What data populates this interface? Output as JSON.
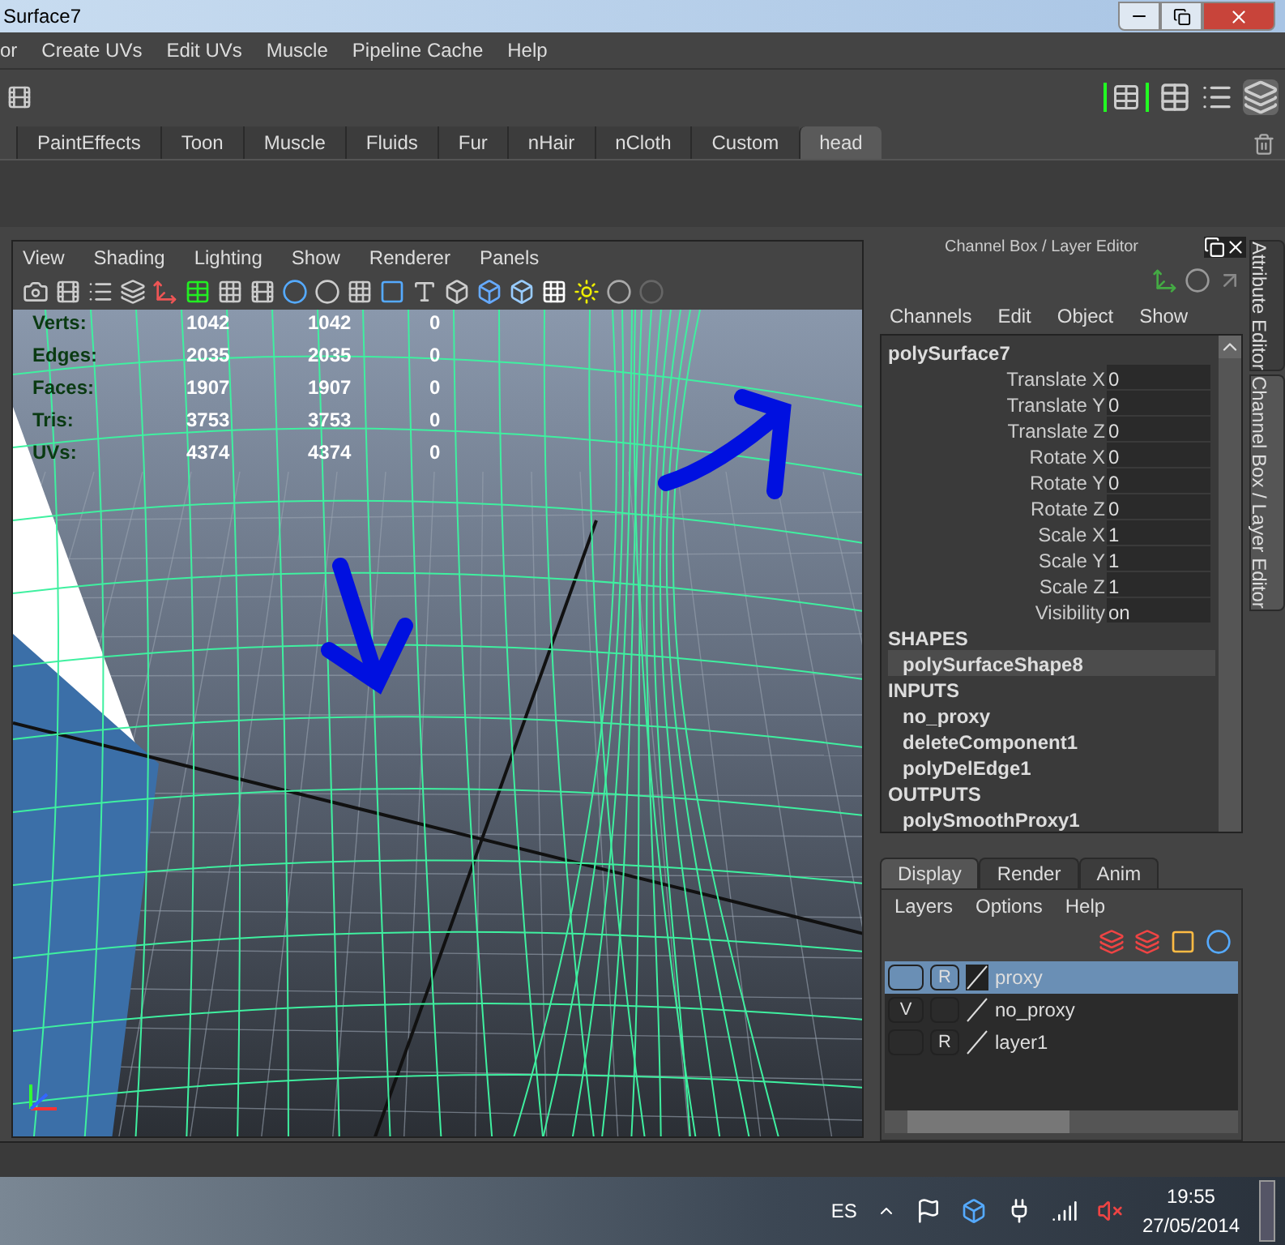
{
  "window": {
    "title": "Surface7"
  },
  "menu_bar": [
    "or",
    "Create UVs",
    "Edit UVs",
    "Muscle",
    "Pipeline Cache",
    "Help"
  ],
  "shelf_tabs": [
    {
      "label": "PaintEffects",
      "selected": false
    },
    {
      "label": "Toon",
      "selected": false
    },
    {
      "label": "Muscle",
      "selected": false
    },
    {
      "label": "Fluids",
      "selected": false
    },
    {
      "label": "Fur",
      "selected": false
    },
    {
      "label": "nHair",
      "selected": false
    },
    {
      "label": "nCloth",
      "selected": false
    },
    {
      "label": "Custom",
      "selected": false
    },
    {
      "label": "head",
      "selected": true
    }
  ],
  "viewport": {
    "menu": [
      "View",
      "Shading",
      "Lighting",
      "Show",
      "Renderer",
      "Panels"
    ],
    "hud": [
      {
        "label": "Verts:",
        "values": [
          "1042",
          "1042",
          "0"
        ]
      },
      {
        "label": "Edges:",
        "values": [
          "2035",
          "2035",
          "0"
        ]
      },
      {
        "label": "Faces:",
        "values": [
          "1907",
          "1907",
          "0"
        ]
      },
      {
        "label": "Tris:",
        "values": [
          "3753",
          "3753",
          "0"
        ]
      },
      {
        "label": "UVs:",
        "values": [
          "4374",
          "4374",
          "0"
        ]
      }
    ]
  },
  "channel_box": {
    "title": "Channel Box / Layer Editor",
    "menu": [
      "Channels",
      "Edit",
      "Object",
      "Show"
    ],
    "object": "polySurface7",
    "attributes": [
      {
        "name": "Translate X",
        "value": "0"
      },
      {
        "name": "Translate Y",
        "value": "0"
      },
      {
        "name": "Translate Z",
        "value": "0"
      },
      {
        "name": "Rotate X",
        "value": "0"
      },
      {
        "name": "Rotate Y",
        "value": "0"
      },
      {
        "name": "Rotate Z",
        "value": "0"
      },
      {
        "name": "Scale X",
        "value": "1"
      },
      {
        "name": "Scale Y",
        "value": "1"
      },
      {
        "name": "Scale Z",
        "value": "1"
      },
      {
        "name": "Visibility",
        "value": "on"
      }
    ],
    "sections": [
      {
        "title": "SHAPES",
        "items": [
          {
            "name": "polySurfaceShape8",
            "selected": true
          }
        ]
      },
      {
        "title": "INPUTS",
        "items": [
          {
            "name": "no_proxy",
            "selected": false
          },
          {
            "name": "deleteComponent1",
            "selected": false
          },
          {
            "name": "polyDelEdge1",
            "selected": false
          }
        ]
      },
      {
        "title": "OUTPUTS",
        "items": [
          {
            "name": "polySmoothProxy1",
            "selected": false
          }
        ]
      }
    ]
  },
  "layer_editor": {
    "tabs": [
      {
        "label": "Display",
        "selected": true
      },
      {
        "label": "Render",
        "selected": false
      },
      {
        "label": "Anim",
        "selected": false
      }
    ],
    "menu": [
      "Layers",
      "Options",
      "Help"
    ],
    "layers": [
      {
        "name": "proxy",
        "selected": true,
        "r": "R"
      },
      {
        "name": "no_proxy",
        "selected": false,
        "v": "V"
      },
      {
        "name": "layer1",
        "selected": false,
        "r": "R"
      }
    ]
  },
  "side_tabs": [
    {
      "label": "Attribute Editor",
      "selected": false
    },
    {
      "label": "Channel Box / Layer Editor",
      "selected": true
    }
  ],
  "taskbar": {
    "language": "ES",
    "time": "19:55",
    "date": "27/05/2014"
  }
}
